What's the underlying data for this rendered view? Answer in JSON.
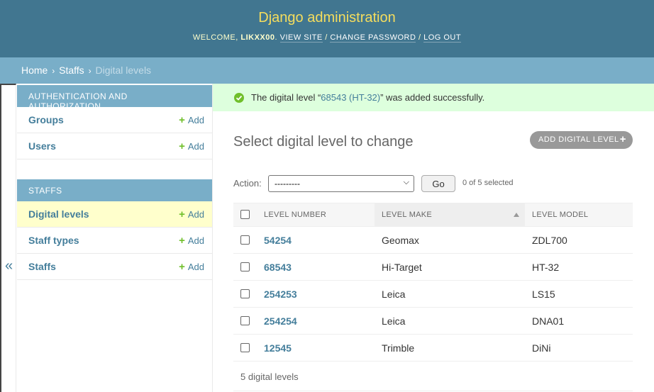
{
  "header": {
    "site_name": "Django administration",
    "welcome": "Welcome,",
    "username": "likxx00",
    "view_site": "View site",
    "change_password": "Change password",
    "log_out": "Log out"
  },
  "breadcrumbs": {
    "home": "Home",
    "app": "Staffs",
    "current": "Digital levels"
  },
  "nav": {
    "toggle": "«",
    "add_label": "Add",
    "modules": [
      {
        "caption": "Authentication and Authorization",
        "items": [
          {
            "name": "Groups"
          },
          {
            "name": "Users"
          }
        ]
      },
      {
        "caption": "Staffs",
        "items": [
          {
            "name": "Digital levels"
          },
          {
            "name": "Staff types"
          },
          {
            "name": "Staffs"
          }
        ]
      }
    ]
  },
  "message": {
    "prefix": "The digital level “",
    "link": "68543 (HT-32)",
    "suffix": "” was added successfully."
  },
  "content": {
    "title": "Select digital level to change",
    "add_button": "Add digital level"
  },
  "actions": {
    "label": "Action:",
    "selected_option": "---------",
    "go": "Go",
    "counter": "0 of 5 selected"
  },
  "table": {
    "columns": [
      "Level number",
      "Level make",
      "Level model"
    ],
    "sorted_column": "Level make",
    "rows": [
      {
        "number": "54254",
        "make": "Geomax",
        "model": "ZDL700"
      },
      {
        "number": "68543",
        "make": "Hi-Target",
        "model": "HT-32"
      },
      {
        "number": "254253",
        "make": "Leica",
        "model": "LS15"
      },
      {
        "number": "254254",
        "make": "Leica",
        "model": "DNA01"
      },
      {
        "number": "12545",
        "make": "Trimble",
        "model": "DiNi"
      }
    ],
    "result_count": "5 digital levels"
  },
  "colors": {
    "header_bg": "#417690",
    "site_name": "#f5dd5d",
    "breadcrumb_bg": "#79aec8",
    "link": "#447e9b",
    "add_plus": "#70bf2b",
    "success_bg": "#ddffdd",
    "current_row": "#ffffcc"
  }
}
